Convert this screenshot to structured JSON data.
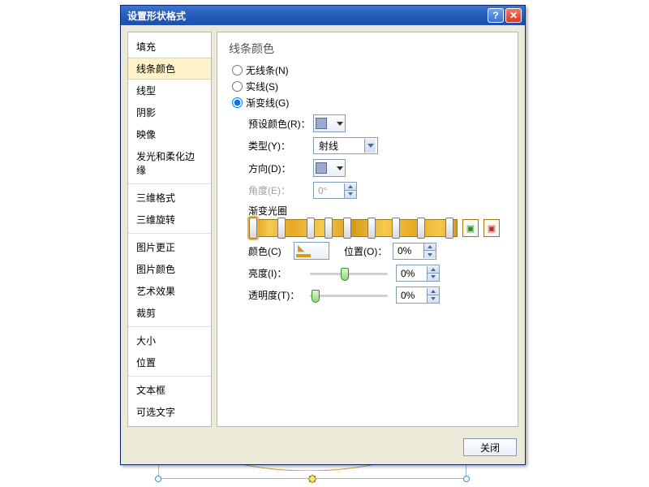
{
  "dialog": {
    "title": "设置形状格式",
    "close_label": "关闭"
  },
  "sidebar": {
    "items": [
      "填充",
      "线条颜色",
      "线型",
      "阴影",
      "映像",
      "发光和柔化边缘",
      "三维格式",
      "三维旋转",
      "图片更正",
      "图片颜色",
      "艺术效果",
      "裁剪",
      "大小",
      "位置",
      "文本框",
      "可选文字"
    ],
    "selected": 1
  },
  "panel": {
    "heading": "线条颜色",
    "radios": {
      "none": "无线条(N)",
      "solid": "实线(S)",
      "gradient": "渐变线(G)"
    },
    "preset_label": "预设颜色(R)：",
    "type_label": "类型(Y)：",
    "type_value": "射线",
    "direction_label": "方向(D)：",
    "angle_label": "角度(E)：",
    "angle_value": "0°",
    "stops_label": "渐变光圈",
    "color_label": "颜色(C)",
    "position_label": "位置(O)：",
    "position_value": "0%",
    "brightness_label": "亮度(I)：",
    "brightness_value": "0%",
    "transparency_label": "透明度(T)：",
    "transparency_value": "0%"
  },
  "chart_data": {
    "type": "table",
    "note": "gradient stop positions along track (percent)",
    "stops": [
      2,
      16,
      30,
      39,
      48,
      60,
      72,
      84,
      98
    ],
    "selected_stop_index": 0
  }
}
